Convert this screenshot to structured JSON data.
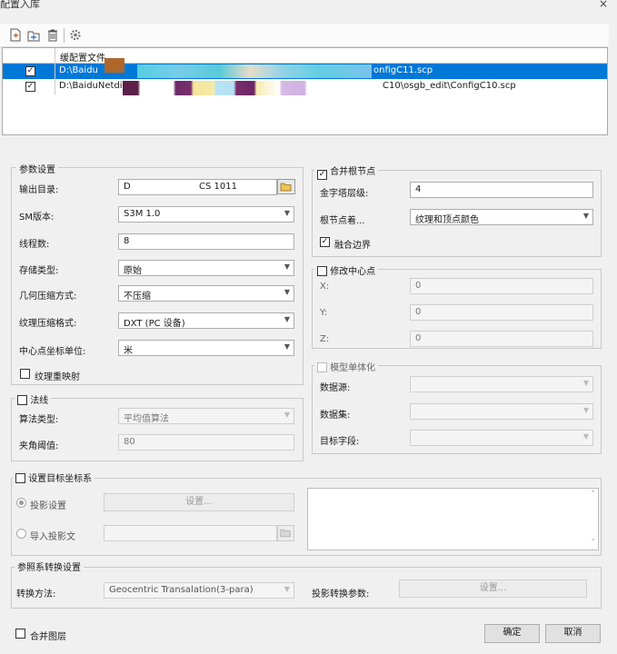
{
  "window": {
    "title": "配置入库",
    "close": "×"
  },
  "toolbar": {
    "icons": [
      "add-file-icon",
      "add-folder-icon",
      "delete-icon",
      "settings-icon"
    ]
  },
  "file_list": {
    "header": "缓配置文件",
    "rows": [
      {
        "checked": true,
        "path_left": "D:\\Baidu",
        "path_right": "onfigC11.scp",
        "selected": true
      },
      {
        "checked": true,
        "path_left": "D:\\BaiduNetdis",
        "path_right": "C10\\osgb_edit\\ConfigC10.scp",
        "selected": false
      }
    ]
  },
  "params": {
    "title": "参数设置",
    "output_dir_label": "输出目录:",
    "output_dir_value": "D",
    "output_dir_value_tail": "CS 1011",
    "version_label": "SM版本:",
    "version_value": "S3M 1.0",
    "threads_label": "线程数:",
    "threads_value": "8",
    "storage_label": "存储类型:",
    "storage_value": "原始",
    "geo_compress_label": "几何压缩方式:",
    "geo_compress_value": "不压缩",
    "tex_compress_label": "纹理压缩格式:",
    "tex_compress_value": "DXT (PC 设备)",
    "center_unit_label": "中心点坐标单位:",
    "center_unit_value": "米",
    "texture_map_label": "纹理重映射"
  },
  "normals": {
    "title": "法线",
    "algo_label": "算法类型:",
    "algo_value": "平均值算法",
    "angle_label": "夹角阈值:",
    "angle_value": "80"
  },
  "merge_root": {
    "title": "合并根节点",
    "checked": true,
    "pyramid_label": "金字塔层级:",
    "pyramid_value": "4",
    "root_label": "根节点着...",
    "root_value": "纹理和顶点颜色",
    "fuse_label": "融合边界",
    "fuse_checked": true
  },
  "modify_center": {
    "title": "修改中心点",
    "x_label": "X:",
    "x_value": "0",
    "y_label": "Y:",
    "y_value": "0",
    "z_label": "Z:",
    "z_value": "0"
  },
  "model_single": {
    "title": "模型单体化",
    "datasource_label": "数据源:",
    "dataset_label": "数据集:",
    "target_field_label": "目标字段:"
  },
  "target_coord": {
    "title": "设置目标坐标系",
    "proj_setting_label": "投影设置",
    "proj_setting_btn": "设置...",
    "import_label": "导入投影文",
    "memo_scroll_up": "˄",
    "memo_scroll_down": "˅"
  },
  "ref_transform": {
    "title": "参照系转换设置",
    "method_label": "转换方法:",
    "method_value": "Geocentric Transalation(3-para)",
    "params_label": "投影转换参数:",
    "params_btn": "设置..."
  },
  "footer": {
    "merge_layers_label": "合并图层",
    "ok": "确定",
    "cancel": "取消"
  },
  "colors": {
    "selection": "#0078d7",
    "background": "#f0f0f0"
  }
}
